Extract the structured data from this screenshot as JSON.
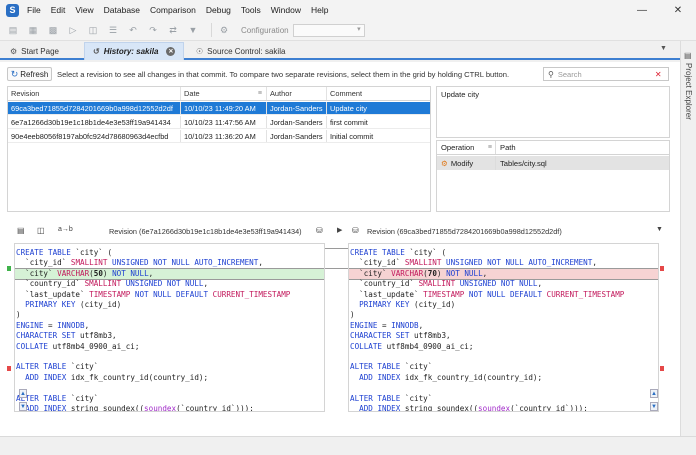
{
  "menu": [
    "File",
    "Edit",
    "View",
    "Database",
    "Comparison",
    "Debug",
    "Tools",
    "Window",
    "Help"
  ],
  "toolbar": {
    "configuration_label": "Configuration"
  },
  "tabs": [
    {
      "label": "Start Page",
      "icon": "gear-icon"
    },
    {
      "label": "History: sakila",
      "icon": "history-icon"
    },
    {
      "label": "Source Control: sakila",
      "icon": "source-control-icon"
    }
  ],
  "side_panel": {
    "label": "Project Explorer"
  },
  "history": {
    "refresh_label": "Refresh",
    "hint": "Select a revision to see all changes in that commit. To compare two separate revisions, select them in the grid by holding CTRL button.",
    "search_placeholder": "Search",
    "columns": [
      "Revision",
      "Date",
      "Author",
      "Comment"
    ],
    "rows": [
      {
        "revision": "69ca3bed71855d7284201669b0a998d12552d2df",
        "date": "10/10/23 11:49:20 AM",
        "author": "Jordan-Sanders",
        "comment": "Update city"
      },
      {
        "revision": "6e7a1266d30b19e1c18b1de4e3e53ff19a941434",
        "date": "10/10/23 11:47:56 AM",
        "author": "Jordan-Sanders",
        "comment": "first commit"
      },
      {
        "revision": "90e4eeb8056f8197ab0fc924d78680963d4ecfbd",
        "date": "10/10/23 11:36:20 AM",
        "author": "Jordan-Sanders",
        "comment": "Initial commit"
      }
    ],
    "comment_text": "Update city",
    "ops_columns": [
      "Operation",
      "Path"
    ],
    "ops_rows": [
      {
        "operation": "Modify",
        "path": "Tables/city.sql"
      }
    ]
  },
  "diff": {
    "left_revision": "Revision (6e7a1266d30b19e1c18b1de4e3e53ff19a941434)",
    "right_revision": "Revision (69ca3bed71855d7284201669b0a998d12552d2df)",
    "left_varchar": "50",
    "right_varchar": "70",
    "colors": {
      "added": "#d6f2d6",
      "removed": "#f6d3d3",
      "keyword": "#1c3fd1",
      "type": "#c2185b"
    }
  }
}
